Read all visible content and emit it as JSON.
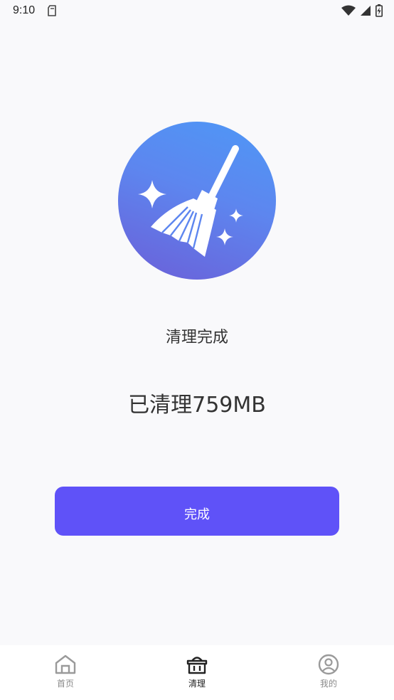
{
  "status_bar": {
    "time": "9:10",
    "icons": [
      "sd-card-icon",
      "wifi-icon",
      "signal-icon",
      "battery-icon"
    ]
  },
  "hero": {
    "icon": "broom-icon",
    "gradient": [
      "#4e98f6",
      "#6b5fd8"
    ]
  },
  "result": {
    "title": "清理完成",
    "amount": "已清理759MB"
  },
  "actions": {
    "done_label": "完成"
  },
  "tabbar": {
    "items": [
      {
        "label": "首页",
        "icon": "home-icon",
        "active": false
      },
      {
        "label": "清理",
        "icon": "clean-basket-icon",
        "active": true
      },
      {
        "label": "我的",
        "icon": "profile-icon",
        "active": false
      }
    ]
  },
  "colors": {
    "accent": "#5f52f8",
    "background": "#f9f9fb",
    "text": "#333333"
  }
}
